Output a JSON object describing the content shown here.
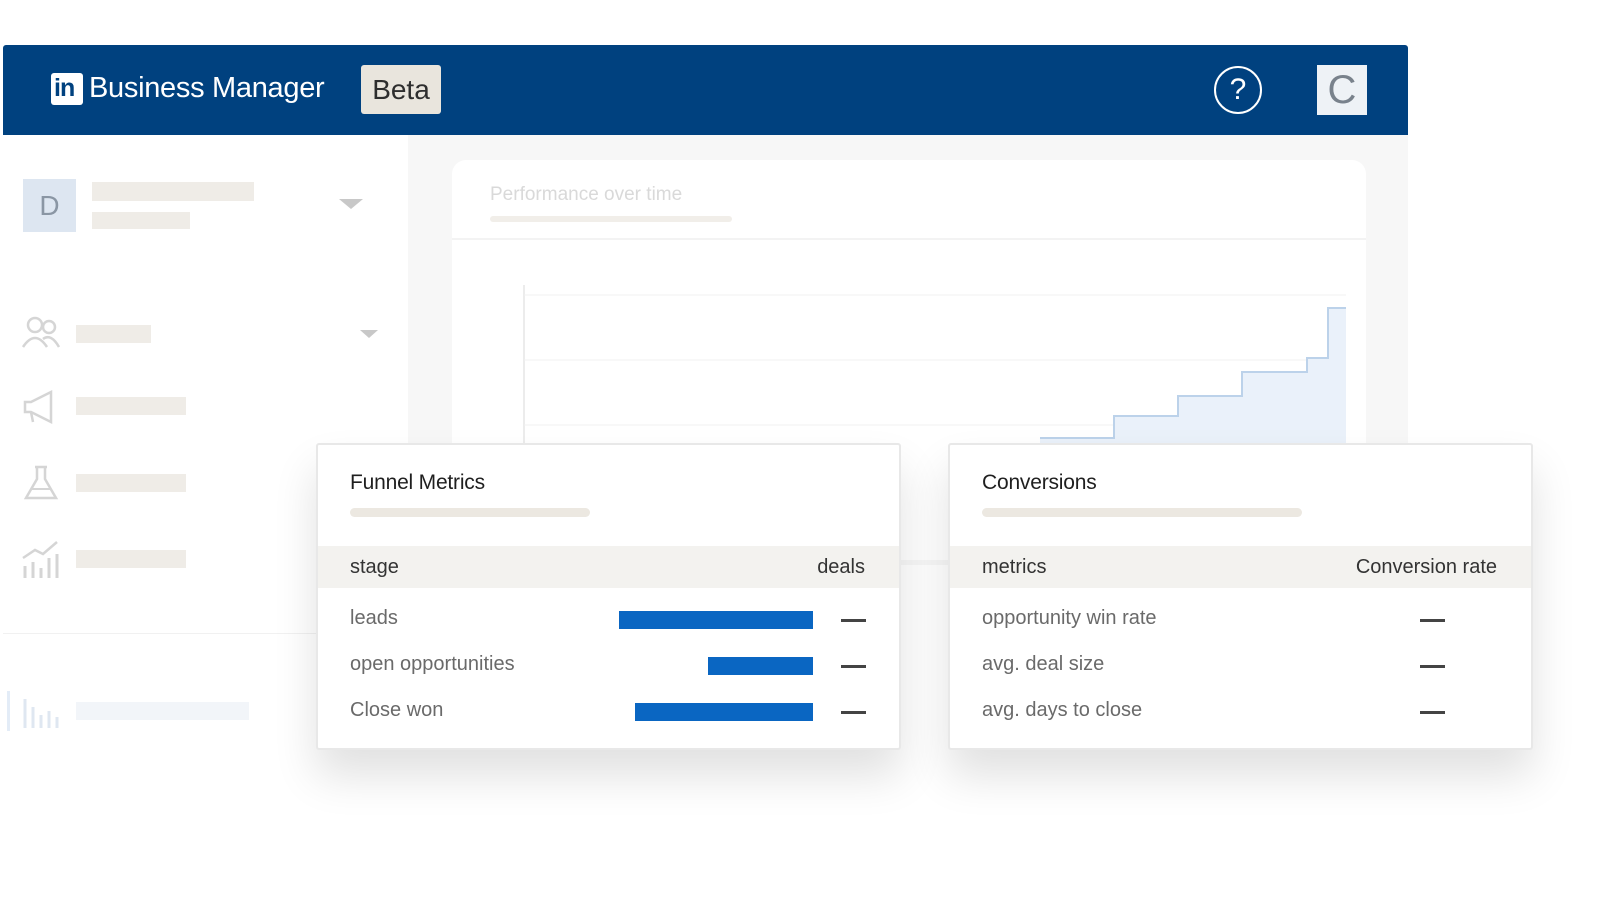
{
  "header": {
    "logo_text": "in",
    "title": "Business Manager",
    "badge": "Beta",
    "help_symbol": "?",
    "user_initial": "C",
    "brand_color": "#00417f"
  },
  "sidebar": {
    "account_initial": "D",
    "icons": [
      "people-icon",
      "megaphone-icon",
      "flask-icon",
      "chart-growth-icon",
      "bar-chart-icon"
    ]
  },
  "performance": {
    "title": "Performance over time",
    "chart_data": {
      "type": "area",
      "x": [],
      "values": [],
      "title": "",
      "grid": true
    }
  },
  "funnel": {
    "title": "Funnel Metrics",
    "col_left": "stage",
    "col_right": "deals",
    "rows": [
      {
        "label": "leads",
        "bar_fraction": 1.0,
        "value": "—"
      },
      {
        "label": "open opportunities",
        "bar_fraction": 0.54,
        "value": "—"
      },
      {
        "label": "Close won",
        "bar_fraction": 0.92,
        "value": "—"
      }
    ],
    "bar_color": "#0a66c2"
  },
  "conversions": {
    "title": "Conversions",
    "col_left": "metrics",
    "col_right": "Conversion rate",
    "rows": [
      {
        "label": "opportunity win rate",
        "value": "—"
      },
      {
        "label": "avg. deal size",
        "value": "—"
      },
      {
        "label": "avg. days to close",
        "value": "—"
      }
    ]
  }
}
